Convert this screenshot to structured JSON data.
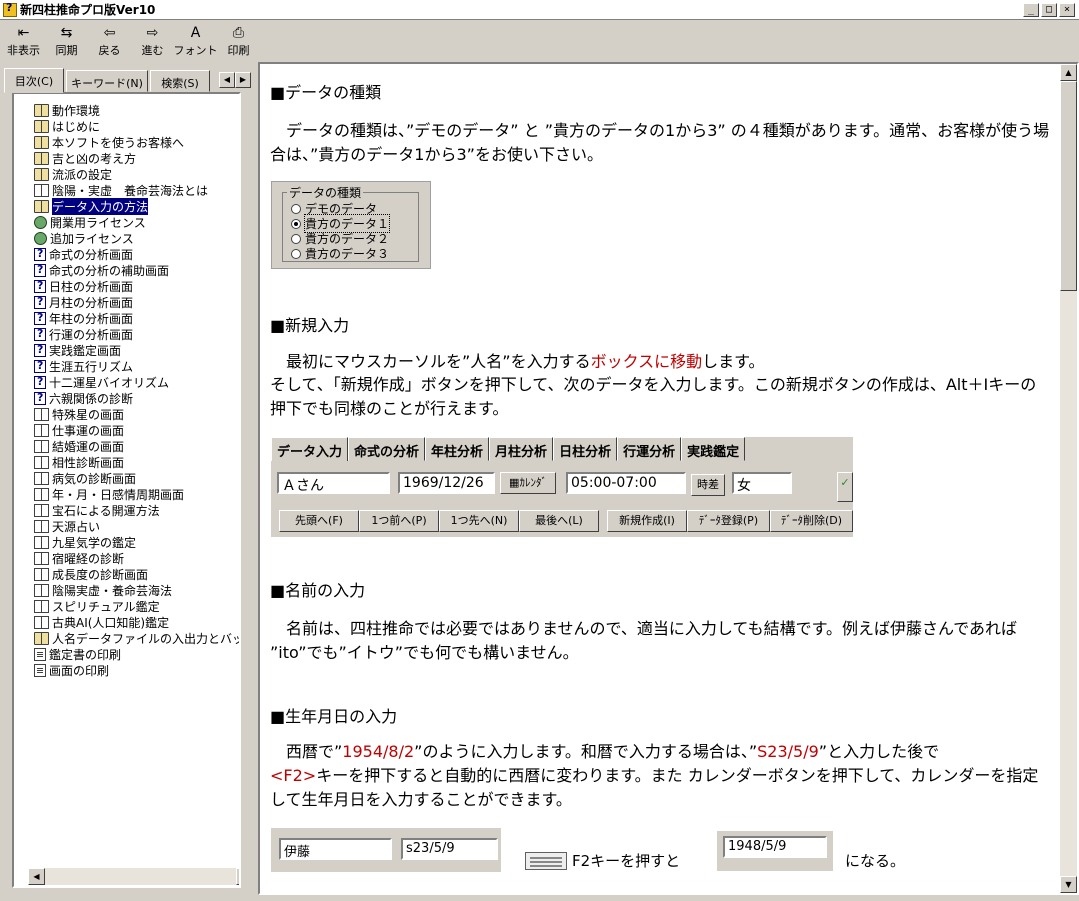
{
  "window": {
    "title": "新四柱推命プロ版Ver10",
    "controls": [
      "_",
      "□",
      "×"
    ]
  },
  "toolbar": [
    {
      "label": "非表示",
      "icon": "hide-icon"
    },
    {
      "label": "同期",
      "icon": "sync-icon"
    },
    {
      "label": "戻る",
      "icon": "back-arrow-icon"
    },
    {
      "label": "進む",
      "icon": "forward-arrow-icon"
    },
    {
      "label": "フォント",
      "icon": "font-icon"
    },
    {
      "label": "印刷",
      "icon": "printer-icon"
    }
  ],
  "tabs": {
    "contents": "目次(C)",
    "keyword": "キーワード(N)",
    "search": "検索(S)"
  },
  "tree": [
    {
      "label": "動作環境",
      "icon": "book"
    },
    {
      "label": "はじめに",
      "icon": "book"
    },
    {
      "label": "本ソフトを使うお客様へ",
      "icon": "book"
    },
    {
      "label": "吉と凶の考え方",
      "icon": "book"
    },
    {
      "label": "流派の設定",
      "icon": "book"
    },
    {
      "label": "陰陽・実虚　養命芸海法とは",
      "icon": "bookopen"
    },
    {
      "label": "データ入力の方法",
      "icon": "book",
      "selected": true
    },
    {
      "label": "開業用ライセンス",
      "icon": "globe"
    },
    {
      "label": "追加ライセンス",
      "icon": "globe"
    },
    {
      "label": "命式の分析画面",
      "icon": "q"
    },
    {
      "label": "命式の分析の補助画面",
      "icon": "q"
    },
    {
      "label": "日柱の分析画面",
      "icon": "q"
    },
    {
      "label": "月柱の分析画面",
      "icon": "q"
    },
    {
      "label": "年柱の分析画面",
      "icon": "q"
    },
    {
      "label": "行運の分析画面",
      "icon": "q"
    },
    {
      "label": "実践鑑定画面",
      "icon": "q"
    },
    {
      "label": "生涯五行リズム",
      "icon": "q"
    },
    {
      "label": "十二運星バイオリズム",
      "icon": "q"
    },
    {
      "label": "六親関係の診断",
      "icon": "q"
    },
    {
      "label": "特殊星の画面",
      "icon": "bookopen"
    },
    {
      "label": "仕事運の画面",
      "icon": "bookopen"
    },
    {
      "label": "結婚運の画面",
      "icon": "bookopen"
    },
    {
      "label": "相性診断画面",
      "icon": "bookopen"
    },
    {
      "label": "病気の診断画面",
      "icon": "bookopen"
    },
    {
      "label": "年・月・日感情周期画面",
      "icon": "bookopen"
    },
    {
      "label": "宝石による開運方法",
      "icon": "bookopen"
    },
    {
      "label": "天源占い",
      "icon": "bookopen"
    },
    {
      "label": "九星気学の鑑定",
      "icon": "bookopen"
    },
    {
      "label": "宿曜経の診断",
      "icon": "bookopen"
    },
    {
      "label": "成長度の診断画面",
      "icon": "bookopen"
    },
    {
      "label": "陰陽実虚・養命芸海法",
      "icon": "bookopen"
    },
    {
      "label": "スピリチュアル鑑定",
      "icon": "bookopen"
    },
    {
      "label": "古典AI(人口知能)鑑定",
      "icon": "bookopen"
    },
    {
      "label": "人名データファイルの入出力とバックアップ",
      "icon": "book"
    },
    {
      "label": "鑑定書の印刷",
      "icon": "page"
    },
    {
      "label": "画面の印刷",
      "icon": "page"
    }
  ],
  "article": {
    "s1_title": "■データの種類",
    "s1_body": "　データの種類は、”デモのデータ” と ”貴方のデータの1から3” の４種類があります。通常、お客様が使う場合は、”貴方のデータ1から3”をお使い下さい。",
    "group": {
      "legend": "データの種類",
      "options": [
        "デモのデータ",
        "貴方のデータ１",
        "貴方のデータ２",
        "貴方のデータ３"
      ]
    },
    "s2_title": "■新規入力",
    "s2_line1a": "　最初にマウスカーソルを”人名”を入力する",
    "s2_line1b": "ボックスに移動",
    "s2_line1c": "します。",
    "s2_line2": "そして、「新規作成」ボタンを押下して、次のデータを入力します。この新規ボタンの作成は、Alt＋Iキーの押下でも同様のことが行えます。",
    "app": {
      "tabs": [
        "データ入力",
        "命式の分析",
        "年柱分析",
        "月柱分析",
        "日柱分析",
        "行運分析",
        "実践鑑定"
      ],
      "name": "Ａさん",
      "date": "1969/12/26",
      "calendar": "ｶﾚﾝﾀﾞ",
      "time": "05:00-07:00",
      "jisa": "時差",
      "gender": "女",
      "nav": [
        "先頭へ(F)",
        "1つ前へ(P)",
        "1つ先へ(N)",
        "最後へ(L)",
        "新規作成(I)",
        "ﾃﾞｰﾀ登録(P)",
        "ﾃﾞｰﾀ削除(D)"
      ]
    },
    "s3_title": "■名前の入力",
    "s3_body": "　名前は、四柱推命では必要ではありませんので、適当に入力しても結構です。例えば伊藤さんであれば ”ito”でも”イトウ”でも何でも構いません。",
    "s4_title": "■生年月日の入力",
    "s4_a": "　西暦で”",
    "s4_b": "1954/8/2",
    "s4_c": "”のように入力します。和暦で入力する場合は、”",
    "s4_d": "S23/5/9",
    "s4_e": "”と入力した後で",
    "s4_f": "<F2>",
    "s4_g": "キーを押下すると自動的に西暦に変わります。また カレンダーボタンを押下して、カレンダーを指定して生年月日を入力することができます。",
    "sample_name": "伊藤",
    "sample_wareki": "s23/5/9",
    "f2_text": "F2キーを押すと",
    "result_date": "1948/5/9",
    "naru": "になる。"
  }
}
